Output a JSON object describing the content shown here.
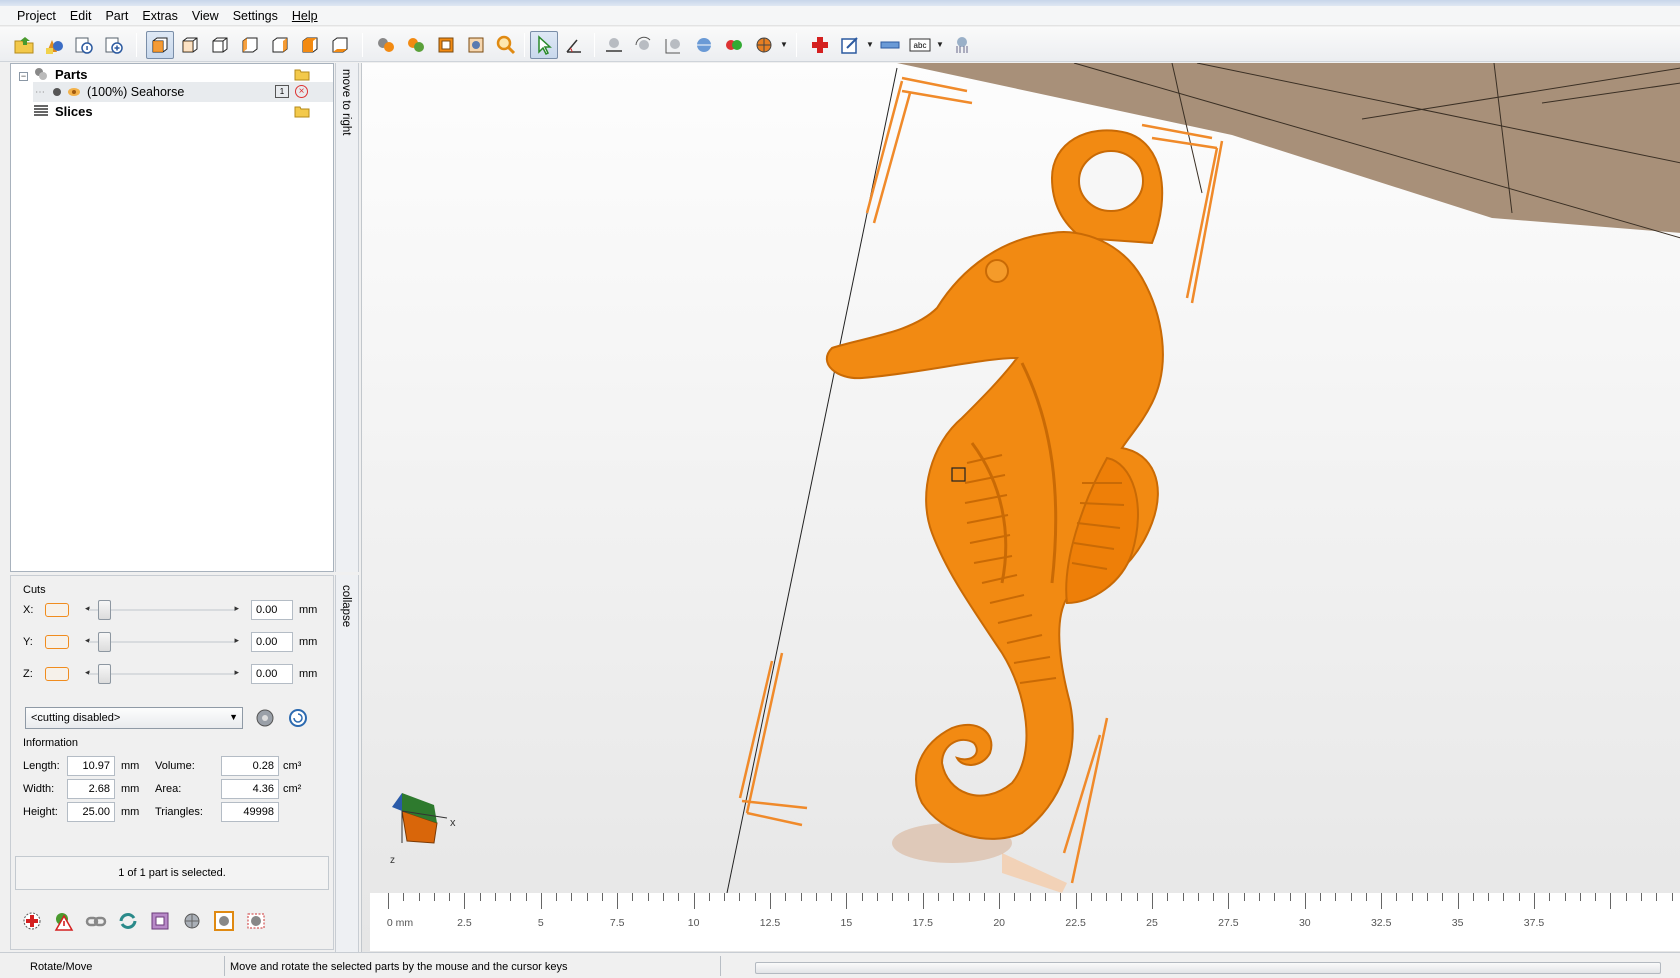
{
  "menu": [
    "Project",
    "Edit",
    "Part",
    "Extras",
    "View",
    "Settings",
    "Help"
  ],
  "toolbar": {
    "icons": [
      "open-project-icon",
      "add-part-icon",
      "part-info-icon",
      "add-copy-icon",
      "view-iso-icon",
      "view-front-icon",
      "view-back-icon",
      "view-left-icon",
      "view-right-icon",
      "view-top-icon",
      "view-bottom-icon",
      "show-parts-icon",
      "show-solid-icon",
      "wireframe-icon",
      "bounding-box-icon",
      "zoom-icon",
      "select-icon",
      "measure-icon",
      "place-on-plate-icon",
      "rotate-part-icon",
      "scale-part-icon",
      "mirror-icon",
      "colors-icon",
      "sphere-mode-icon",
      "repair-icon",
      "export-icon",
      "ruler-icon",
      "text-label-icon",
      "support-icon"
    ]
  },
  "tree": {
    "parts_label": "Parts",
    "part_name": "(100%) Seahorse",
    "part_count": "1",
    "slices_label": "Slices"
  },
  "sidetabs": {
    "move": "move to right",
    "collapse": "collapse"
  },
  "cuts": {
    "title": "Cuts",
    "axes": [
      {
        "label": "X:",
        "value": "0.00",
        "unit": "mm"
      },
      {
        "label": "Y:",
        "value": "0.00",
        "unit": "mm"
      },
      {
        "label": "Z:",
        "value": "0.00",
        "unit": "mm"
      }
    ],
    "mode": "<cutting disabled>"
  },
  "information": {
    "title": "Information",
    "length_label": "Length:",
    "length": "10.97",
    "length_unit": "mm",
    "width_label": "Width:",
    "width": "2.68",
    "width_unit": "mm",
    "height_label": "Height:",
    "height": "25.00",
    "height_unit": "mm",
    "volume_label": "Volume:",
    "volume": "0.28",
    "volume_unit": "cm³",
    "area_label": "Area:",
    "area": "4.36",
    "area_unit": "cm²",
    "triangles_label": "Triangles:",
    "triangles": "49998"
  },
  "selection_text": "1 of 1 part is selected.",
  "ruler": {
    "labels": [
      "0 mm",
      "2.5",
      "5",
      "7.5",
      "10",
      "12.5",
      "15",
      "17.5",
      "20",
      "22.5",
      "25",
      "27.5",
      "30",
      "32.5",
      "35",
      "37.5"
    ],
    "axis_x": "x",
    "axis_z": "z"
  },
  "status": {
    "mode": "Rotate/Move",
    "hint": "Move and rotate the selected parts by the mouse and the cursor keys"
  },
  "colors": {
    "part": "#f28a12",
    "platform": "#a89079",
    "bbox": "#f08a2a"
  }
}
